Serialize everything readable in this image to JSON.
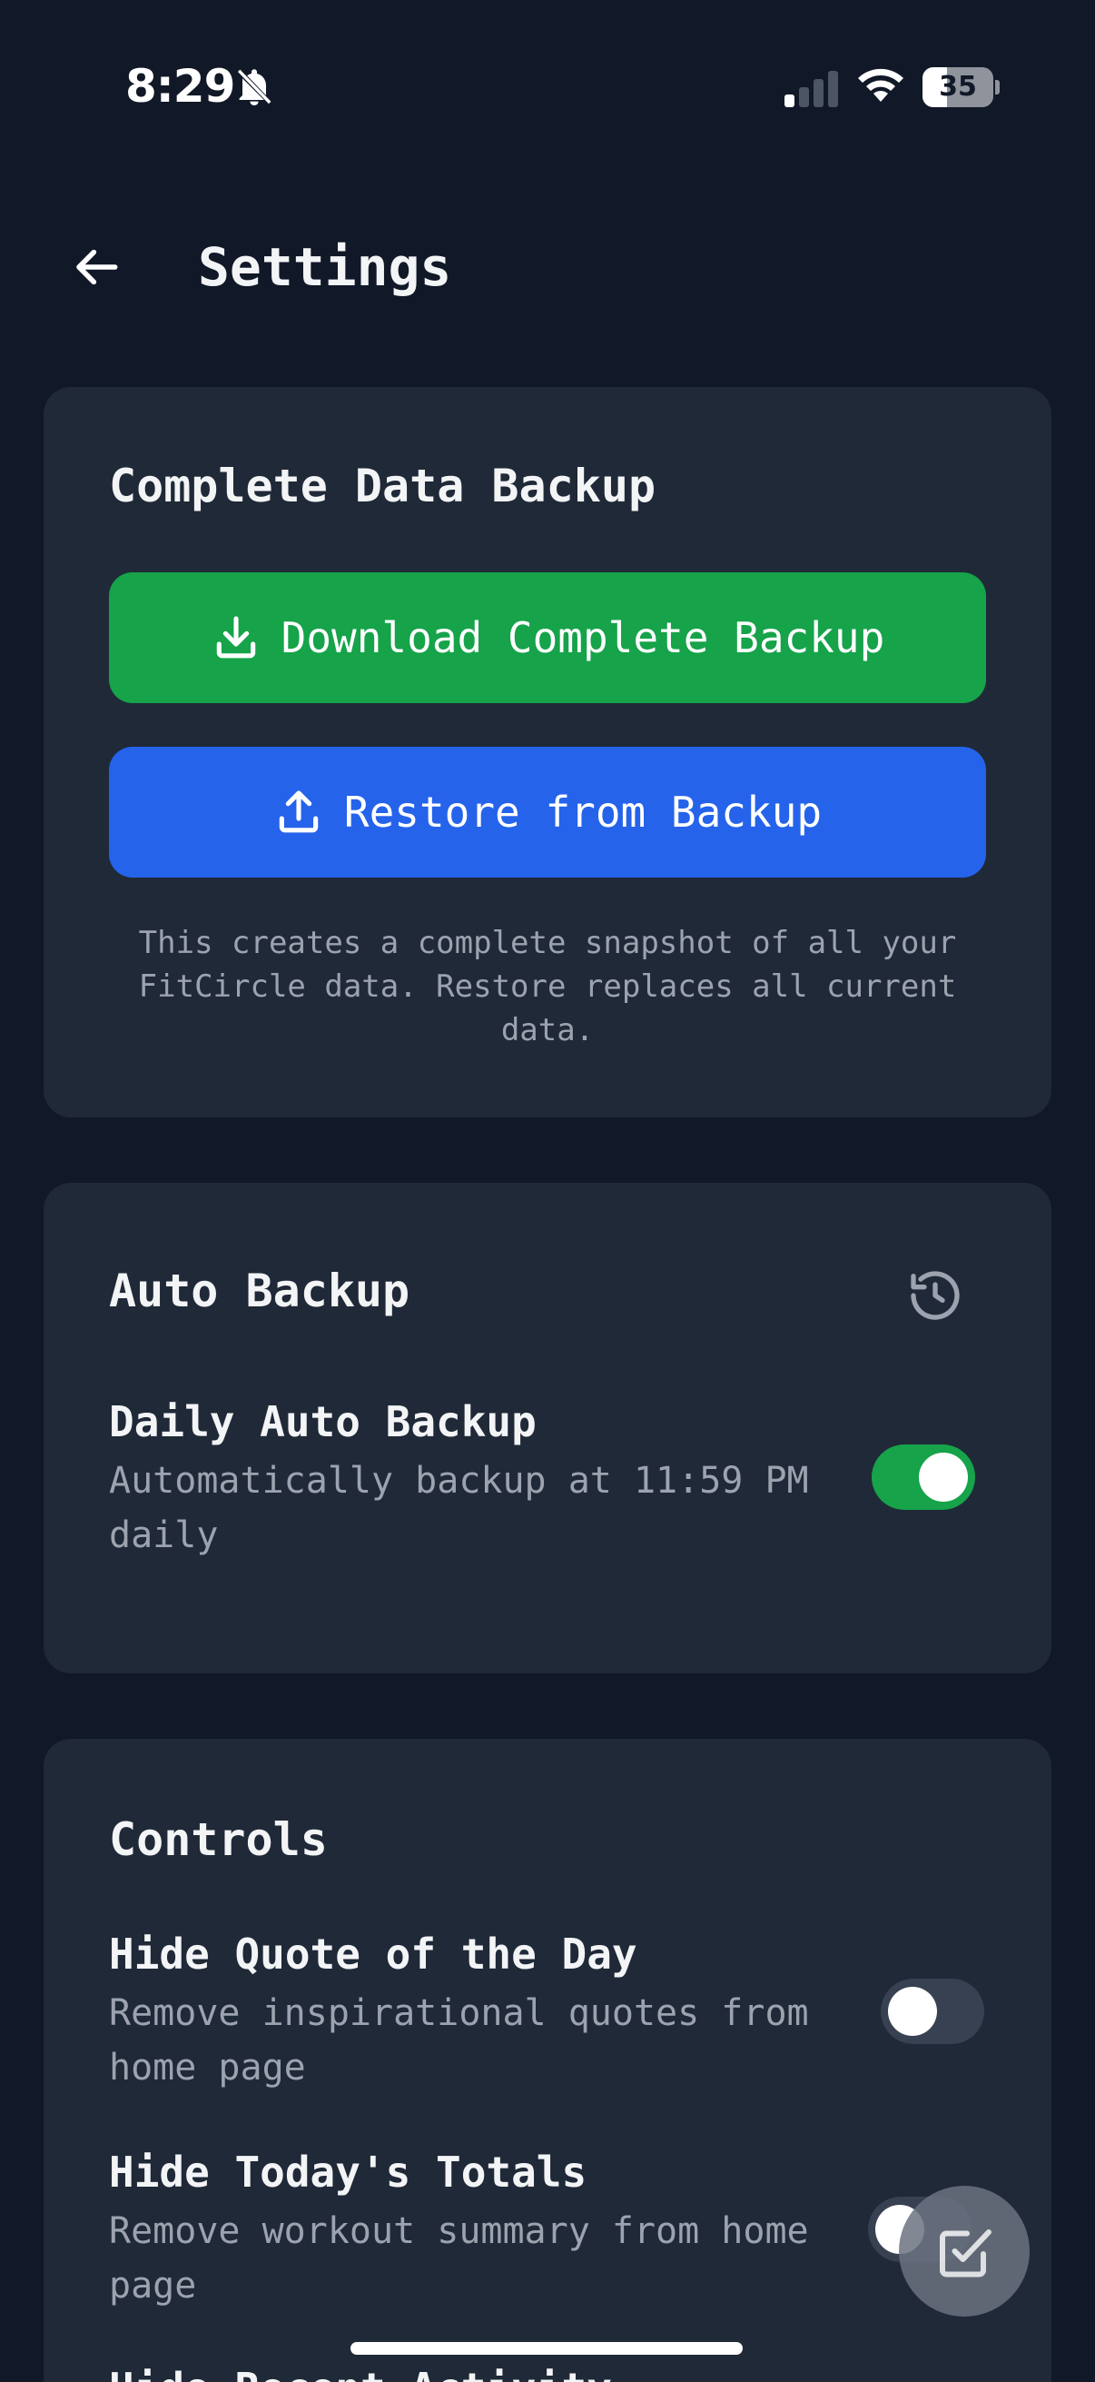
{
  "status_bar": {
    "time": "8:29",
    "battery_level": "35",
    "battery_percent": 35,
    "signal_bars_active": 1,
    "signal_bars_total": 4
  },
  "header": {
    "title": "Settings",
    "back_icon": "arrow-left-icon"
  },
  "backup_card": {
    "title": "Complete Data Backup",
    "download_label": "Download Complete Backup",
    "download_icon": "download-icon",
    "restore_label": "Restore from Backup",
    "restore_icon": "upload-icon",
    "note": "This creates a complete snapshot of all your FitCircle data. Restore replaces all current data."
  },
  "auto_backup_card": {
    "title": "Auto Backup",
    "icon": "history-icon",
    "daily": {
      "title": "Daily Auto Backup",
      "description": "Automatically backup at 11:59 PM daily",
      "enabled": true
    }
  },
  "controls_card": {
    "title": "Controls",
    "items": [
      {
        "title": "Hide Quote of the Day",
        "description": "Remove inspirational quotes from home page",
        "enabled": false
      },
      {
        "title": "Hide Today's Totals",
        "description": "Remove workout summary from home page",
        "enabled": false
      },
      {
        "title": "Hide Recent Activity"
      }
    ]
  },
  "fab": {
    "icon": "checkbox-edit-icon"
  },
  "colors": {
    "background": "#111827",
    "card": "#1f2937",
    "green": "#16a34a",
    "blue": "#2563eb",
    "muted_text": "#9ca3af"
  }
}
